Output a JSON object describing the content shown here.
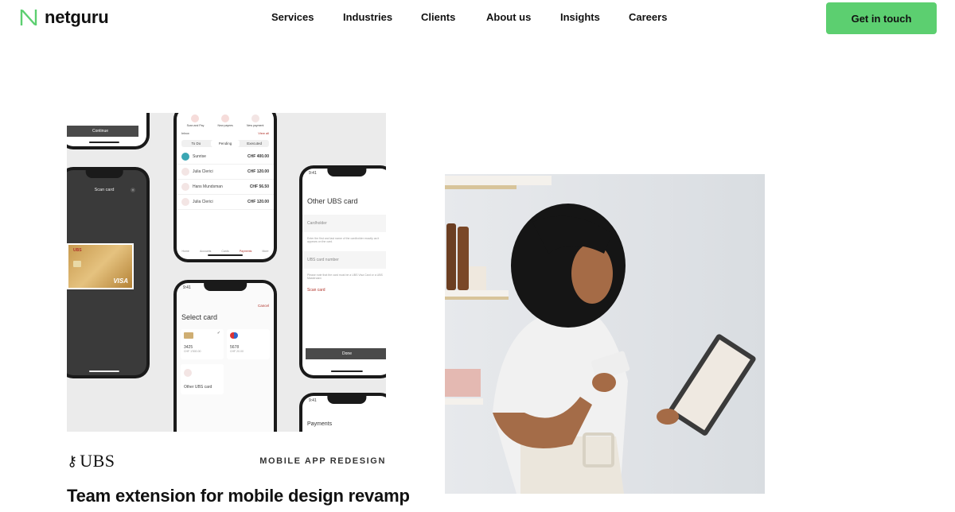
{
  "brand": {
    "name": "netguru",
    "accent": "#5ccf70"
  },
  "nav": {
    "links": [
      "Services",
      "Industries",
      "Clients",
      "About us",
      "Insights",
      "Careers"
    ],
    "cta_label": "Get in touch"
  },
  "case_study": {
    "client": "UBS",
    "tag": "MOBILE APP REDESIGN",
    "title": "Team extension for mobile design revamp",
    "mockups": {
      "continue_label": "Continue",
      "scan_card_title": "Scan card",
      "card_brand": "VISA",
      "card_issuer": "UBS",
      "actions": [
        "Scan and Pay",
        "New payees",
        "New payment"
      ],
      "inbox_label": "Inbox",
      "view_all": "View all",
      "segments": [
        "To Do",
        "Pending",
        "Executed"
      ],
      "transactions": [
        {
          "name": "Sunrise",
          "amount": "CHF 400.00"
        },
        {
          "name": "Julia Clerici",
          "amount": "CHF 120.00"
        },
        {
          "name": "Hans Mundsman",
          "amount": "CHF 56.50"
        },
        {
          "name": "Julia Clerici",
          "amount": "CHF 120.00"
        }
      ],
      "tabbar": [
        "Home",
        "Accounts",
        "Cards",
        "Payments",
        "More"
      ],
      "time": "9:41",
      "other_card_title": "Other UBS card",
      "cardholder_placeholder": "Cardholder",
      "card_number_placeholder": "UBS card number",
      "scan_card_link": "Scan card",
      "done_label": "Done",
      "select_card_title": "Select card",
      "cancel_label": "Cancel",
      "cards": [
        {
          "number": "3425",
          "balance": "CHF 1'500.00"
        },
        {
          "number": "5678",
          "balance": "CHF 20.00"
        }
      ],
      "other_card_tile": "Other UBS card",
      "payments_title": "Payments"
    }
  },
  "photo": {
    "alt": "Woman holding a payment card and a tablet"
  }
}
